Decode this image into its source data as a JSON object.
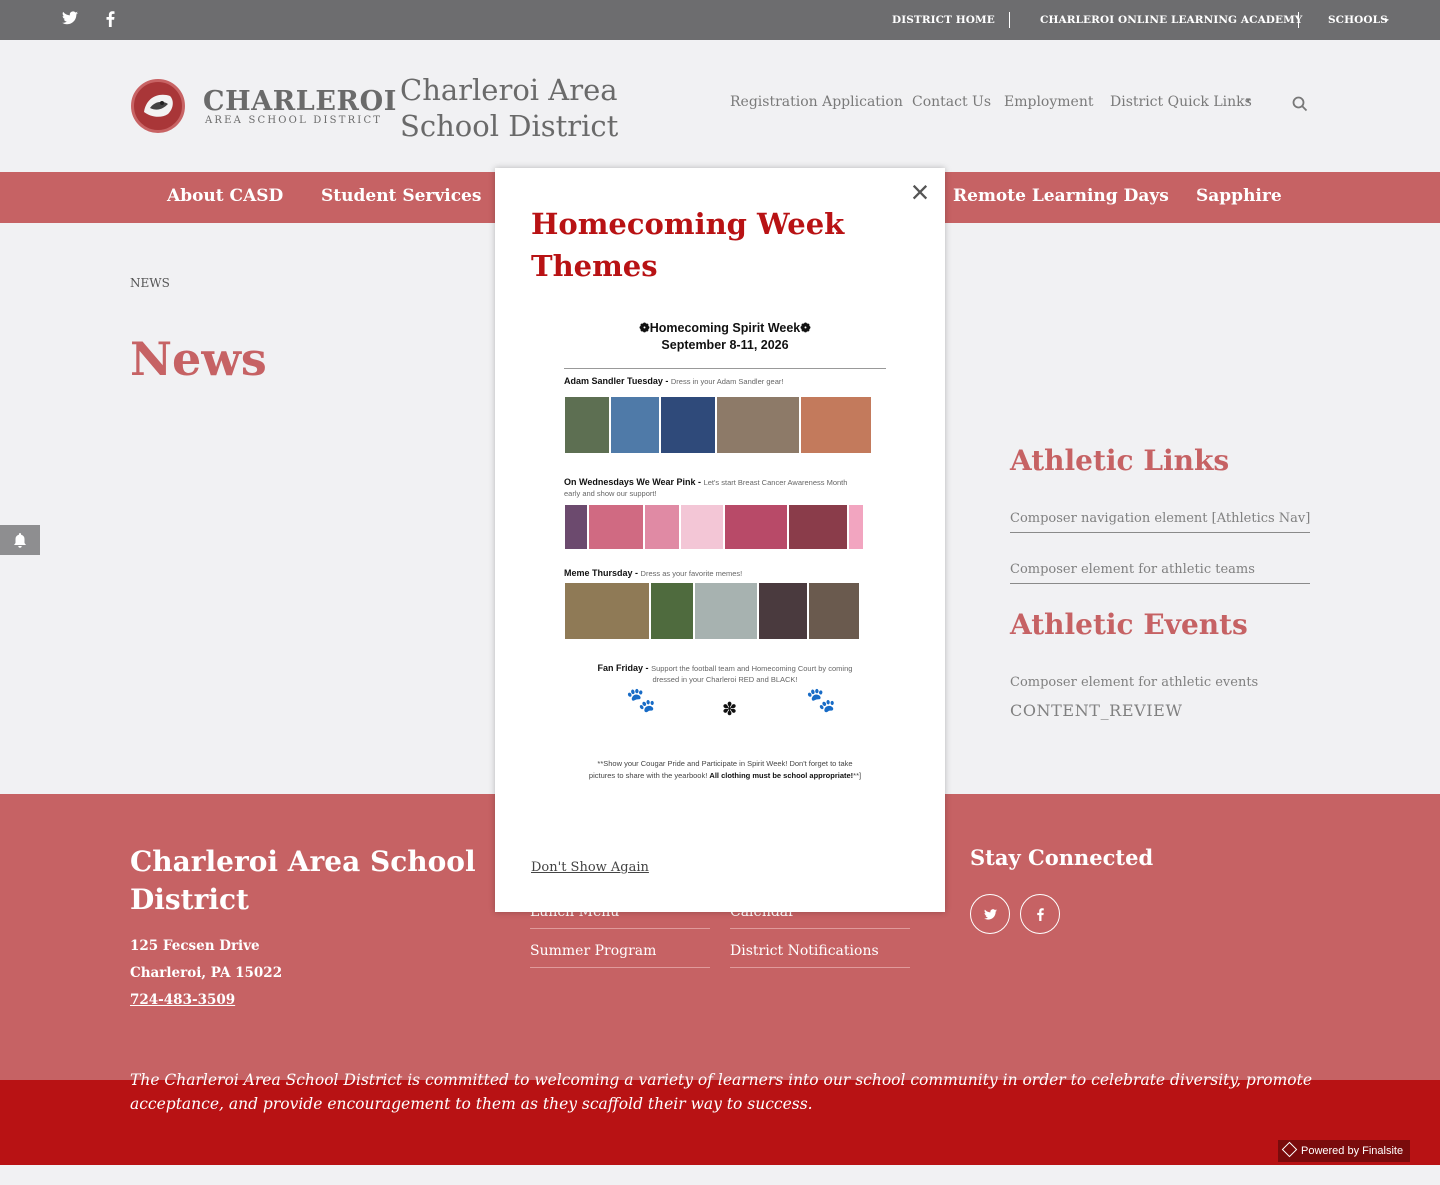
{
  "topbar": {
    "links": [
      "DISTRICT HOME",
      "CHARLEROI ONLINE LEARNING ACADEMY",
      "SCHOOLS"
    ],
    "social": [
      "twitter-icon",
      "facebook-icon"
    ]
  },
  "header": {
    "logo_word": "CHARLEROI",
    "logo_sub": "AREA SCHOOL DISTRICT",
    "site_title": "Charleroi Area School District",
    "nav": [
      "Registration Application",
      "Contact Us",
      "Employment",
      "District Quick Links"
    ]
  },
  "main_nav": [
    "About CASD",
    "Student Services",
    "Remote Learning Days",
    "Sapphire"
  ],
  "content": {
    "breadcrumb": "NEWS",
    "page_title": "News"
  },
  "sidebar": {
    "athletic_links_heading": "Athletic Links",
    "athletic_links": [
      "Composer navigation element [Athletics Nav]",
      "Composer element for athletic teams"
    ],
    "athletic_events_heading": "Athletic Events",
    "athletic_events_text": "Composer element for athletic events",
    "content_review": "CONTENT_REVIEW"
  },
  "footer": {
    "title": "Charleroi Area School District",
    "address_line1": "125 Fecsen Drive",
    "address_line2": "Charleroi, PA  15022",
    "phone": "724-483-3509",
    "links_col1": [
      "Lunch Menu",
      "Summer Program"
    ],
    "links_col2": [
      "Calendar",
      "District Notifications"
    ],
    "stay_connected": "Stay Connected",
    "mission": "The Charleroi Area School District is committed to welcoming a variety of learners into our school community in order to celebrate diversity, promote acceptance, and provide encouragement to them as they scaffold their way to success.",
    "powered_by": "Powered by Finalsite"
  },
  "modal": {
    "title": "Homecoming Week Themes",
    "dont_show_again": "Don't Show Again",
    "flyer": {
      "heading": "Homecoming Spirit Week",
      "dates": "September 8-11, 2026",
      "days": [
        {
          "name": "Adam Sandler Tuesday -",
          "desc": "Dress in your Adam Sandler gear!"
        },
        {
          "name": "On Wednesdays We Wear Pink -",
          "desc": "Let's start Breast Cancer Awareness Month",
          "desc2": "early and show our support!"
        },
        {
          "name": "Meme Thursday -",
          "desc": "Dress as your favorite memes!"
        },
        {
          "name": "Fan Friday -",
          "desc": "Support the football team and Homecoming Court by coming",
          "desc2": "dressed in your Charleroi RED and BLACK!"
        }
      ],
      "note_line1": "**Show your Cougar Pride and Participate in Spirit Week!  Don't forget to take",
      "note_line2a": "pictures to share with the yearbook!",
      "note_line2b": "All clothing must be school appropriate!",
      "note_line2c": "**]"
    }
  },
  "colors": {
    "brand_red": "#c66264",
    "dark_red": "#b81214",
    "topbar_gray": "#6d6d6f"
  }
}
